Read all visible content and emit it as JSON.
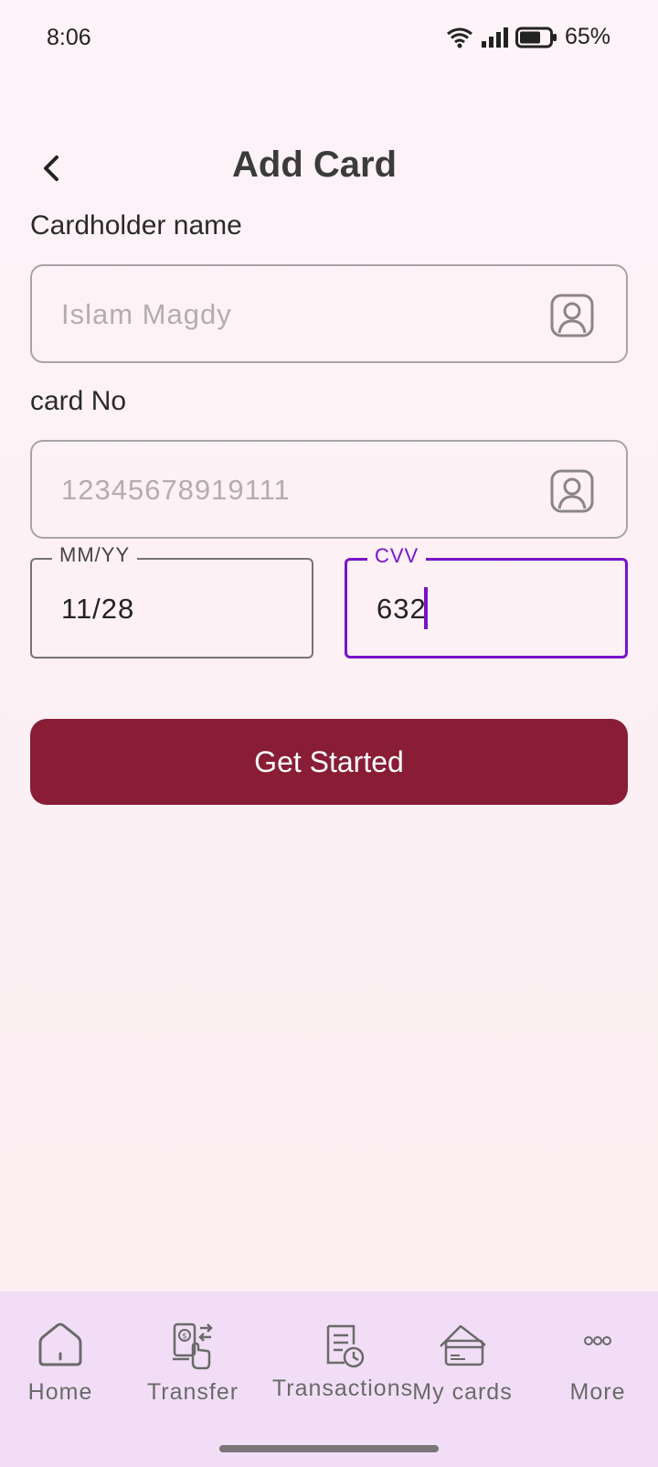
{
  "status_bar": {
    "time": "8:06",
    "battery": "65%"
  },
  "header": {
    "title": "Add Card"
  },
  "form": {
    "cardholder": {
      "label": "Cardholder name",
      "placeholder": "Islam Magdy",
      "value": ""
    },
    "card_no": {
      "label": "card No",
      "placeholder": "12345678919111",
      "value": ""
    },
    "expiry": {
      "label": "MM/YY",
      "value": "11/28"
    },
    "cvv": {
      "label": "CVV",
      "value": "632"
    },
    "submit_label": "Get Started"
  },
  "colors": {
    "primary": "#881d35",
    "focus": "#7a12c9",
    "nav_background": "#f1def6"
  },
  "bottom_nav": {
    "items": [
      {
        "label": "Home",
        "icon": "home-icon"
      },
      {
        "label": "Transfer",
        "icon": "transfer-icon"
      },
      {
        "label": "Transactions",
        "icon": "transactions-icon"
      },
      {
        "label": "My cards",
        "icon": "cards-icon"
      },
      {
        "label": "More",
        "icon": "more-icon"
      }
    ]
  }
}
